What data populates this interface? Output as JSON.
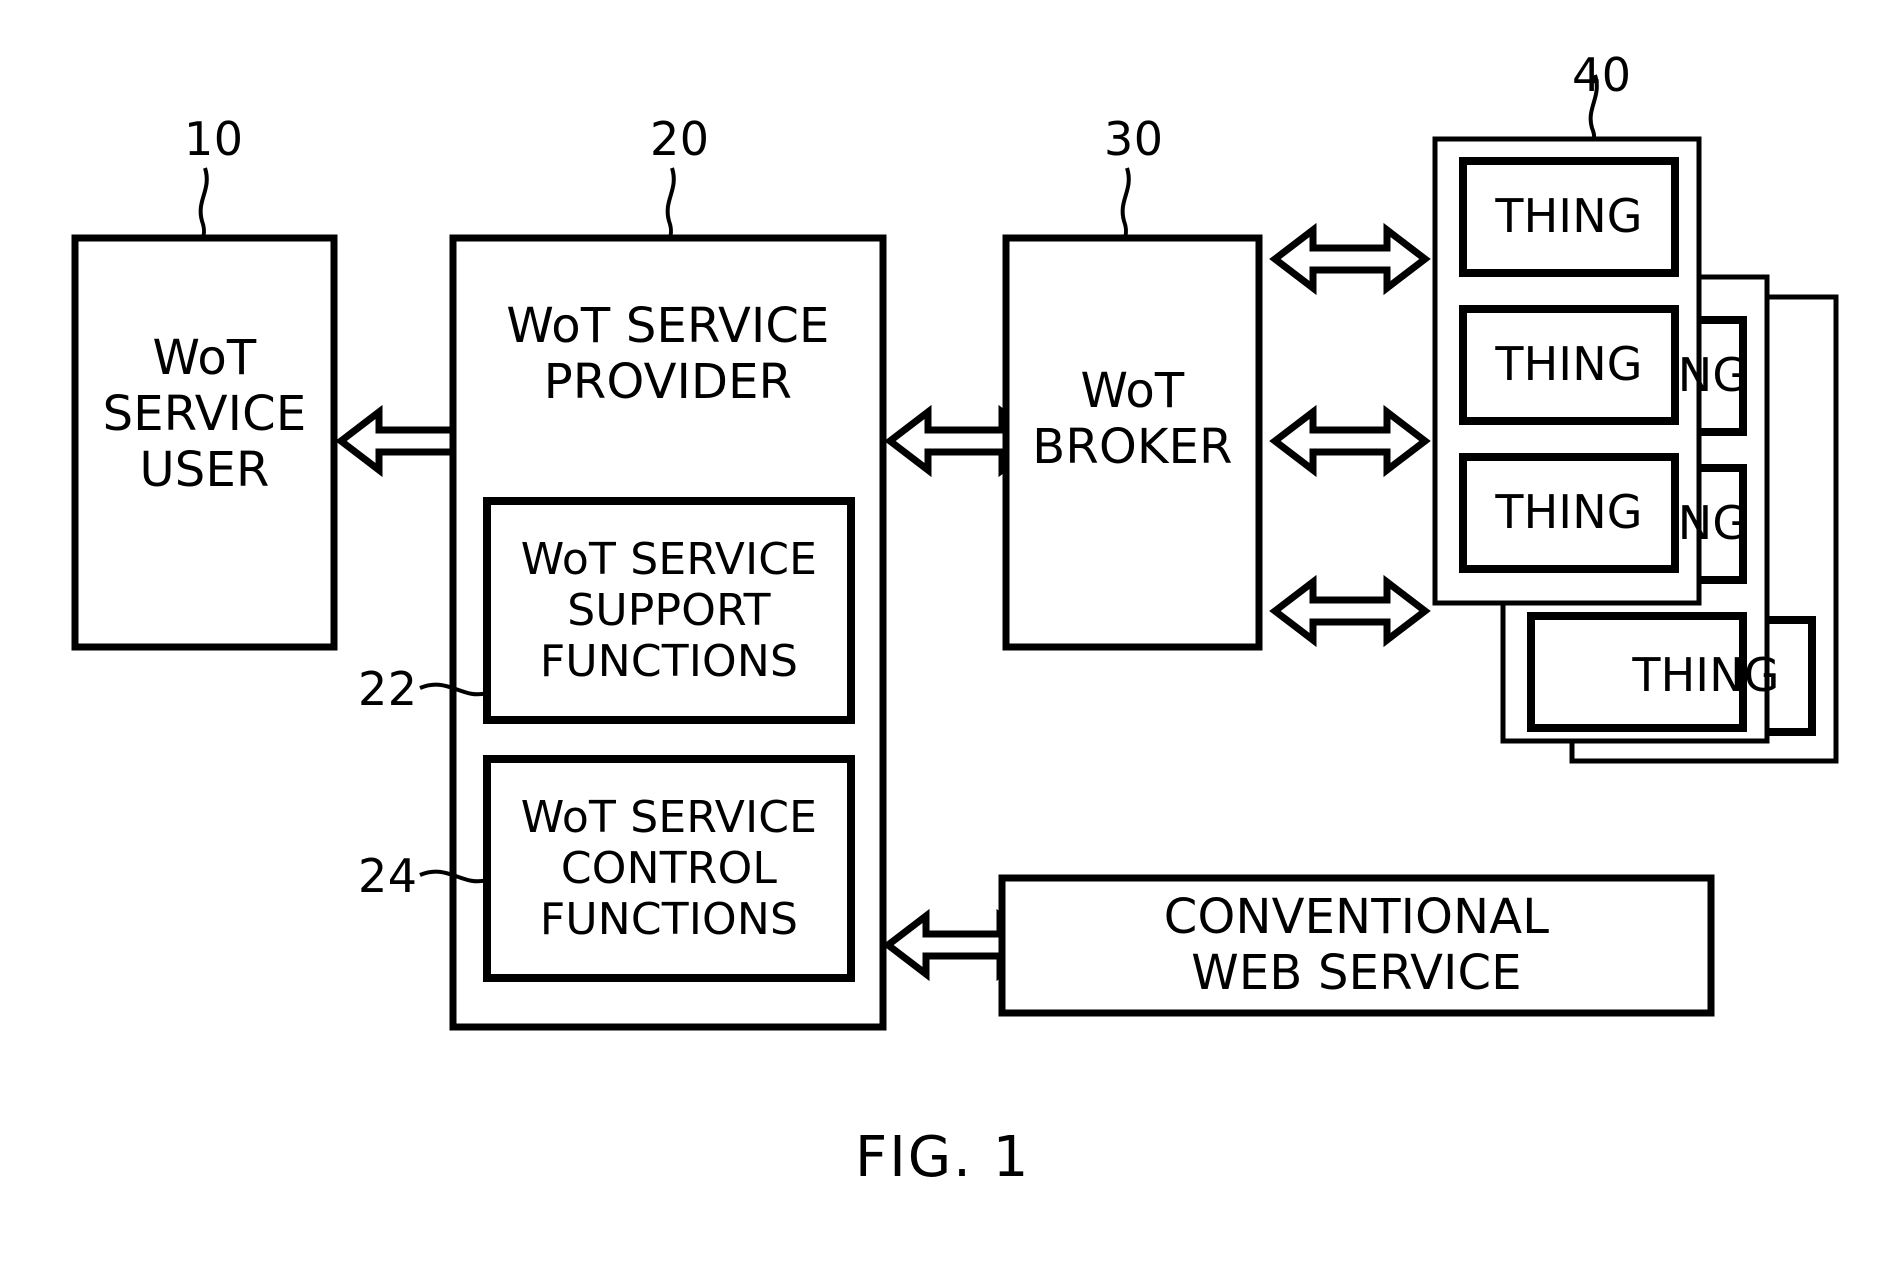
{
  "figure": {
    "caption": "FIG. 1",
    "reference_numerals": [
      {
        "id": "10",
        "target": "wot-service-user"
      },
      {
        "id": "20",
        "target": "wot-service-provider"
      },
      {
        "id": "22",
        "target": "wot-service-support-functions"
      },
      {
        "id": "24",
        "target": "wot-service-control-functions"
      },
      {
        "id": "30",
        "target": "wot-broker"
      },
      {
        "id": "40",
        "target": "thing-group"
      }
    ]
  },
  "blocks": {
    "service_user": {
      "label": "WoT\nSERVICE\nUSER",
      "ref": "10"
    },
    "service_provider": {
      "label": "WoT SERVICE\nPROVIDER",
      "ref": "20"
    },
    "support_functions": {
      "label": "WoT SERVICE\nSUPPORT\nFUNCTIONS",
      "ref": "22"
    },
    "control_functions": {
      "label": "WoT SERVICE\nCONTROL\nFUNCTIONS",
      "ref": "24"
    },
    "broker": {
      "label": "WoT\nBROKER",
      "ref": "30"
    },
    "conventional_web_service": {
      "label": "CONVENTIONAL\nWEB SERVICE"
    }
  },
  "thing_group": {
    "ref": "40",
    "layers": [
      {
        "things": [
          "THING",
          "THING",
          "THING"
        ]
      },
      {
        "things": [
          "NG",
          "NG",
          "THING"
        ]
      },
      {
        "things": [
          "THING"
        ]
      }
    ],
    "front_layer_labels": [
      "THING",
      "THING",
      "THING"
    ],
    "middle_layer_labels": [
      "NG",
      "NG"
    ],
    "back_layer_label": "THING"
  },
  "connectors": [
    {
      "name": "user-to-provider",
      "type": "double-arrow",
      "orientation": "horizontal"
    },
    {
      "name": "provider-to-broker",
      "type": "double-arrow",
      "orientation": "horizontal"
    },
    {
      "name": "broker-to-thing-1",
      "type": "double-arrow",
      "orientation": "horizontal"
    },
    {
      "name": "broker-to-thing-2",
      "type": "double-arrow",
      "orientation": "horizontal"
    },
    {
      "name": "broker-to-thing-3",
      "type": "double-arrow",
      "orientation": "horizontal"
    },
    {
      "name": "provider-to-web-service",
      "type": "double-arrow",
      "orientation": "horizontal"
    }
  ],
  "colors": {
    "stroke": "#000000",
    "background": "#ffffff"
  }
}
